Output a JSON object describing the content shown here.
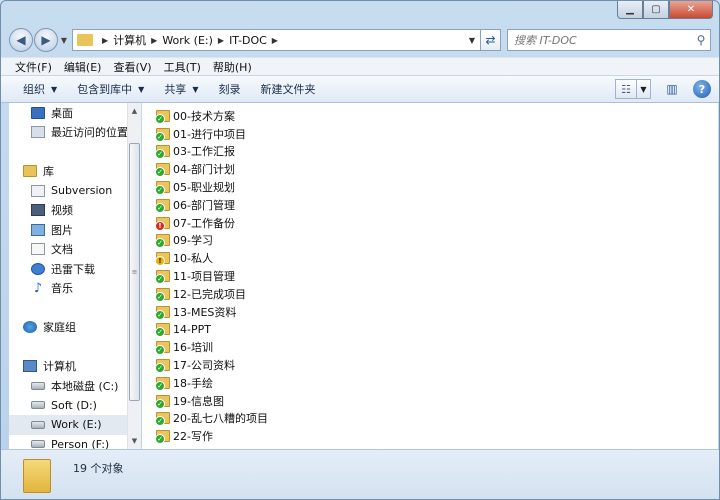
{
  "address": {
    "crumbs": [
      "计算机",
      "Work (E:)",
      "IT-DOC"
    ],
    "search_placeholder": "搜索 IT-DOC"
  },
  "menu": [
    "文件(F)",
    "编辑(E)",
    "查看(V)",
    "工具(T)",
    "帮助(H)"
  ],
  "toolbar": {
    "organize": "组织",
    "include_library": "包含到库中",
    "share": "共享",
    "burn": "刻录",
    "new_folder": "新建文件夹",
    "help": "?"
  },
  "nav": {
    "favorites": [
      "桌面",
      "最近访问的位置"
    ],
    "libraries_header": "库",
    "libraries": [
      "Subversion",
      "视频",
      "图片",
      "文档",
      "迅雷下载",
      "音乐"
    ],
    "homegroup": "家庭组",
    "computer_header": "计算机",
    "drives": [
      "本地磁盘 (C:)",
      "Soft (D:)",
      "Work (E:)",
      "Person (F:)"
    ],
    "selected_drive": "Work (E:)"
  },
  "files": [
    {
      "name": "00-技术方案",
      "status": "ok"
    },
    {
      "name": "01-进行中项目",
      "status": "ok"
    },
    {
      "name": "03-工作汇报",
      "status": "ok"
    },
    {
      "name": "04-部门计划",
      "status": "ok"
    },
    {
      "name": "05-职业规划",
      "status": "ok"
    },
    {
      "name": "06-部门管理",
      "status": "ok"
    },
    {
      "name": "07-工作备份",
      "status": "conflict"
    },
    {
      "name": "09-学习",
      "status": "ok"
    },
    {
      "name": "10-私人",
      "status": "warn"
    },
    {
      "name": "11-项目管理",
      "status": "ok"
    },
    {
      "name": "12-已完成项目",
      "status": "ok"
    },
    {
      "name": "13-MES资料",
      "status": "ok"
    },
    {
      "name": "14-PPT",
      "status": "ok"
    },
    {
      "name": "16-培训",
      "status": "ok"
    },
    {
      "name": "17-公司资料",
      "status": "ok"
    },
    {
      "name": "18-手绘",
      "status": "ok"
    },
    {
      "name": "19-信息图",
      "status": "ok"
    },
    {
      "name": "20-乱七八糟的项目",
      "status": "ok"
    },
    {
      "name": "22-写作",
      "status": "ok"
    }
  ],
  "status": {
    "count_text": "19 个对象"
  }
}
